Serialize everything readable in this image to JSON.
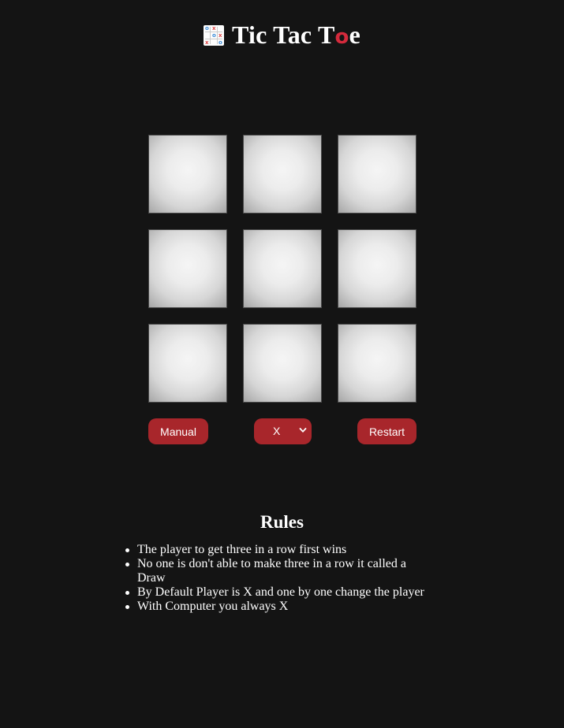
{
  "header": {
    "logo_icon": "tic-tac-toe-grid-icon",
    "title_prefix": "Tic Tac T",
    "title_accent": "o",
    "title_suffix": "e",
    "accent_color": "#d42a3c"
  },
  "board": {
    "cells": [
      "",
      "",
      "",
      "",
      "",
      "",
      "",
      "",
      ""
    ]
  },
  "controls": {
    "manual_label": "Manual",
    "player_select_value": "X",
    "player_select_icon": "chevron-down-icon",
    "restart_label": "Restart",
    "button_color": "#a8262b"
  },
  "rules": {
    "title": "Rules",
    "items": [
      "The player to get three in a row first wins",
      "No one is don't able to make three in a row it called a Draw",
      "By Default Player is X and one by one change the player",
      "With Computer you always X"
    ]
  },
  "colors": {
    "background": "#141414",
    "text": "#ffffff"
  }
}
